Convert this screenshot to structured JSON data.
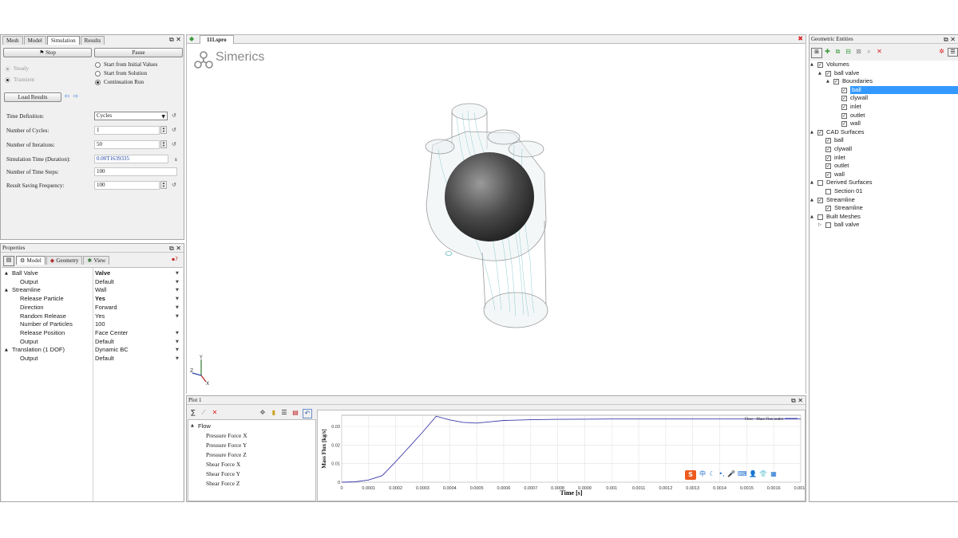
{
  "simulation_panel": {
    "tabs": [
      "Mesh",
      "Model",
      "Simulation",
      "Results"
    ],
    "stop_label": "Stop",
    "pause_label": "Pause",
    "steady_label": "Steady",
    "transient_label": "Transient",
    "start_options": [
      "Start from Initial Values",
      "Start from Solution",
      "Continuation Run"
    ],
    "selected_start": "Continuation Run",
    "load_results_label": "Load Results",
    "fields": {
      "time_definition": {
        "label": "Time Definition:",
        "value": "Cycles"
      },
      "num_cycles": {
        "label": "Number of Cycles:",
        "value": "1"
      },
      "num_iterations": {
        "label": "Number of Iterations:",
        "value": "50"
      },
      "sim_time": {
        "label": "Simulation Time (Duration):",
        "value": "0.00T1639335",
        "unit": "s"
      },
      "num_time_steps": {
        "label": "Number of Time Steps:",
        "value": "100"
      },
      "result_saving": {
        "label": "Result Saving Frequency:",
        "value": "100"
      }
    }
  },
  "properties_panel": {
    "title": "Properties",
    "tabs": [
      "Model",
      "Geometry",
      "View"
    ],
    "rows": [
      {
        "key": "Ball Valve",
        "value": "Valve",
        "level": 0,
        "expander": "▲",
        "bold": true,
        "dropdown": true
      },
      {
        "key": "Output",
        "value": "Default",
        "level": 1,
        "expander": "",
        "bold": false,
        "dropdown": true
      },
      {
        "key": "Streamline",
        "value": "Wall",
        "level": 0,
        "expander": "▲",
        "bold": false,
        "dropdown": true
      },
      {
        "key": "Release Particle",
        "value": "Yes",
        "level": 1,
        "expander": "",
        "bold": true,
        "dropdown": true
      },
      {
        "key": "Direction",
        "value": "Forward",
        "level": 1,
        "expander": "",
        "bold": false,
        "dropdown": true
      },
      {
        "key": "Random Release",
        "value": "Yes",
        "level": 1,
        "expander": "",
        "bold": false,
        "dropdown": true
      },
      {
        "key": "Number of Particles",
        "value": "100",
        "level": 1,
        "expander": "",
        "bold": false,
        "dropdown": false
      },
      {
        "key": "Release Position",
        "value": "Face Center",
        "level": 1,
        "expander": "",
        "bold": false,
        "dropdown": true
      },
      {
        "key": "Output",
        "value": "Default",
        "level": 1,
        "expander": "",
        "bold": false,
        "dropdown": true
      },
      {
        "key": "Translation (1 DOF)",
        "value": "Dynamic BC",
        "level": 0,
        "expander": "▲",
        "bold": false,
        "dropdown": true
      },
      {
        "key": "Output",
        "value": "Default",
        "level": 1,
        "expander": "",
        "bold": false,
        "dropdown": true
      }
    ]
  },
  "document_tab": {
    "label": "111.spro"
  },
  "viewport": {
    "logo_text": "Simerics"
  },
  "plot_panel": {
    "title": "Plot 1",
    "tree_root": "Flow",
    "tree_items": [
      "Pressure Force X",
      "Pressure Force Y",
      "Pressure Force Z",
      "Shear Force X",
      "Shear Force Y",
      "Shear Force Z"
    ]
  },
  "chart_data": {
    "type": "line",
    "title": "",
    "xlabel": "Time [s]",
    "ylabel": "Mass Flux [kg/s]",
    "xlim": [
      0,
      0.0017
    ],
    "ylim": [
      0,
      0.036
    ],
    "x_ticks": [
      "0",
      "0.0001",
      "0.0002",
      "0.0003",
      "0.0004",
      "0.0005",
      "0.0006",
      "0.0007",
      "0.0008",
      "0.0009",
      "0.001",
      "0.0011",
      "0.0012",
      "0.0013",
      "0.0014",
      "0.0015",
      "0.0016",
      "0.0017"
    ],
    "y_ticks": [
      "0",
      "0.01",
      "0.02",
      "0.03"
    ],
    "grid": true,
    "legend_position": "top-right",
    "series_color": "#3a3aa8",
    "series": [
      {
        "name": "Flow - Mass Flux outlet",
        "x": [
          0,
          5e-05,
          0.0001,
          0.00015,
          0.0002,
          0.00025,
          0.0003,
          0.00035,
          0.0004,
          0.00045,
          0.0005,
          0.00055,
          0.0006,
          0.0007,
          0.0008,
          0.0009,
          0.001,
          0.0011,
          0.0012,
          0.0013,
          0.0014,
          0.0015,
          0.0016,
          0.0017
        ],
        "y": [
          0,
          0.0002,
          0.0012,
          0.0035,
          0.011,
          0.019,
          0.027,
          0.0355,
          0.0335,
          0.0322,
          0.0318,
          0.0325,
          0.0332,
          0.0336,
          0.0338,
          0.0339,
          0.034,
          0.034,
          0.034,
          0.034,
          0.034,
          0.034,
          0.034,
          0.034
        ]
      }
    ]
  },
  "geometric_entities": {
    "title": "Geometric Entities",
    "tree": [
      {
        "label": "Volumes",
        "level": 0,
        "checked": true,
        "expander": "▲",
        "selected": false
      },
      {
        "label": "ball valve",
        "level": 1,
        "checked": true,
        "expander": "▲",
        "selected": false
      },
      {
        "label": "Boundaries",
        "level": 2,
        "checked": true,
        "expander": "▲",
        "selected": false
      },
      {
        "label": "ball",
        "level": 3,
        "checked": true,
        "expander": "",
        "selected": true
      },
      {
        "label": "clywall",
        "level": 3,
        "checked": true,
        "expander": "",
        "selected": false
      },
      {
        "label": "inlet",
        "level": 3,
        "checked": true,
        "expander": "",
        "selected": false
      },
      {
        "label": "outlet",
        "level": 3,
        "checked": true,
        "expander": "",
        "selected": false
      },
      {
        "label": "wall",
        "level": 3,
        "checked": true,
        "expander": "",
        "selected": false
      },
      {
        "label": "CAD Surfaces",
        "level": 0,
        "checked": true,
        "expander": "▲",
        "selected": false
      },
      {
        "label": "ball",
        "level": 1,
        "checked": true,
        "expander": "",
        "selected": false
      },
      {
        "label": "clywall",
        "level": 1,
        "checked": true,
        "expander": "",
        "selected": false
      },
      {
        "label": "inlet",
        "level": 1,
        "checked": true,
        "expander": "",
        "selected": false
      },
      {
        "label": "outlet",
        "level": 1,
        "checked": true,
        "expander": "",
        "selected": false
      },
      {
        "label": "wall",
        "level": 1,
        "checked": true,
        "expander": "",
        "selected": false
      },
      {
        "label": "Derived Surfaces",
        "level": 0,
        "checked": false,
        "expander": "▲",
        "selected": false
      },
      {
        "label": "Section 01",
        "level": 1,
        "checked": false,
        "expander": "",
        "selected": false
      },
      {
        "label": "Streamline",
        "level": 0,
        "checked": true,
        "expander": "▲",
        "selected": false
      },
      {
        "label": "Streamline",
        "level": 1,
        "checked": true,
        "expander": "",
        "selected": false
      },
      {
        "label": "Built Meshes",
        "level": 0,
        "checked": false,
        "expander": "▲",
        "selected": false
      },
      {
        "label": "ball valve",
        "level": 1,
        "checked": false,
        "expander": "▷",
        "selected": false
      }
    ]
  },
  "colors": {
    "selection": "#3399ff",
    "accent_red": "#d92020",
    "green": "#3c9a3c"
  }
}
